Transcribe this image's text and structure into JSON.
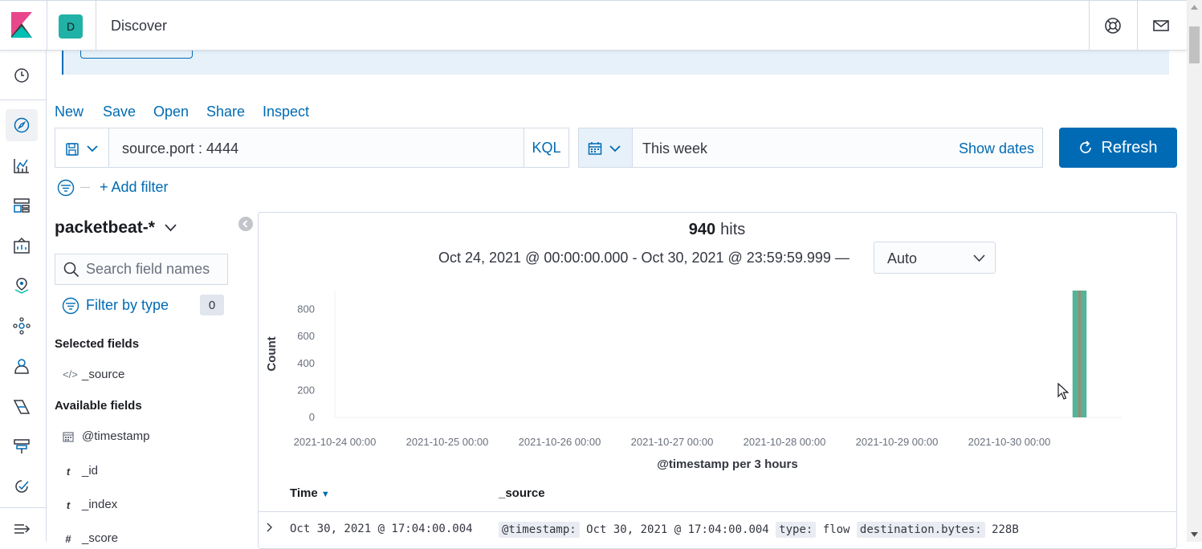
{
  "header": {
    "space_initial": "D",
    "app_title": "Discover"
  },
  "top_menu": {
    "new": "New",
    "save": "Save",
    "open": "Open",
    "share": "Share",
    "inspect": "Inspect"
  },
  "query": {
    "text": "source.port : 4444",
    "language": "KQL"
  },
  "date_picker": {
    "value": "This week",
    "show_dates": "Show dates"
  },
  "refresh": {
    "label": "Refresh"
  },
  "filters": {
    "add_label": "+ Add filter"
  },
  "sidebar": {
    "index_pattern": "packetbeat-*",
    "search_placeholder": "Search field names",
    "filter_by_type": "Filter by type",
    "filter_count": "0",
    "selected_title": "Selected fields",
    "selected_fields": [
      {
        "icon": "</>",
        "name": "_source"
      }
    ],
    "available_title": "Available fields",
    "available_fields": [
      {
        "icon": "calendar",
        "name": "@timestamp"
      },
      {
        "icon": "t",
        "name": "_id"
      },
      {
        "icon": "t",
        "name": "_index"
      },
      {
        "icon": "#",
        "name": "_score"
      }
    ]
  },
  "results": {
    "hits_count": "940",
    "hits_label": "hits",
    "date_range": "Oct 24, 2021 @ 00:00:00.000 - Oct 30, 2021 @ 23:59:59.999 —",
    "interval": "Auto"
  },
  "chart_data": {
    "type": "bar",
    "title": "",
    "ylabel": "Count",
    "xlabel": "@timestamp per 3 hours",
    "ylim": [
      0,
      940
    ],
    "y_ticks": [
      "0",
      "200",
      "400",
      "600",
      "800"
    ],
    "x_ticks": [
      "2021-10-24 00:00",
      "2021-10-25 00:00",
      "2021-10-26 00:00",
      "2021-10-27 00:00",
      "2021-10-28 00:00",
      "2021-10-29 00:00",
      "2021-10-30 00:00"
    ],
    "series": [
      {
        "x": "2021-10-30 15:00",
        "values": [
          940
        ]
      }
    ],
    "bar_color": "#54b399"
  },
  "table": {
    "col_time": "Time",
    "col_source": "_source",
    "rows": [
      {
        "time": "Oct 30, 2021 @ 17:04:00.004",
        "k1": "@timestamp:",
        "v1": "Oct 30, 2021 @ 17:04:00.004",
        "k2": "type:",
        "v2": "flow",
        "k3": "destination.bytes:",
        "v3": "228B"
      }
    ]
  }
}
